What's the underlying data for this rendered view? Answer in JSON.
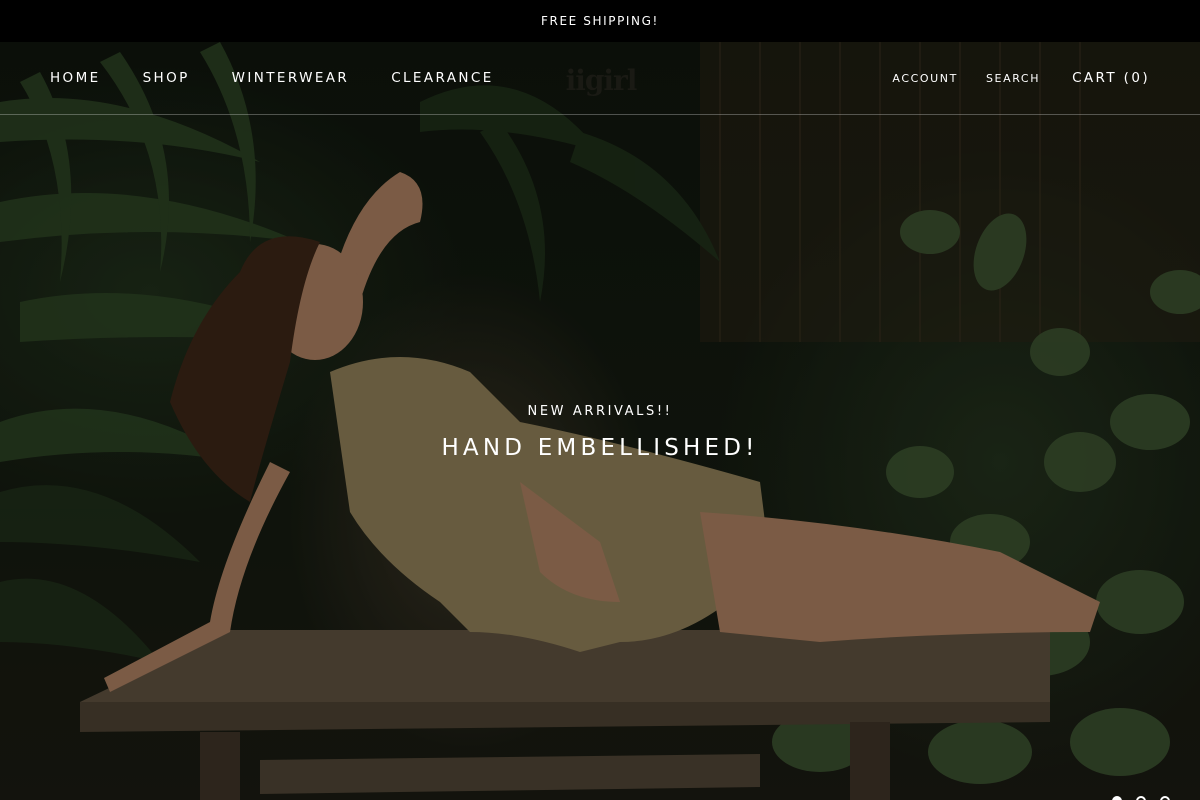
{
  "announcement": {
    "text": "FREE SHIPPING!"
  },
  "header": {
    "logo_text": "iigirl",
    "nav_links": [
      "HOME",
      "SHOP",
      "WINTERWEAR",
      "CLEARANCE"
    ],
    "account_label": "ACCOUNT",
    "search_label": "SEARCH",
    "cart_label": "CART (0)"
  },
  "hero": {
    "subheading": "NEW ARRIVALS!!",
    "heading": "HAND EMBELLISHED!",
    "slides_count": 3,
    "active_slide": 1
  },
  "colors": {
    "announcement_bg": "#000000",
    "text": "#ffffff",
    "foliage": "#22301c",
    "dress": "#8a7a55",
    "bench": "#6b5c48"
  }
}
